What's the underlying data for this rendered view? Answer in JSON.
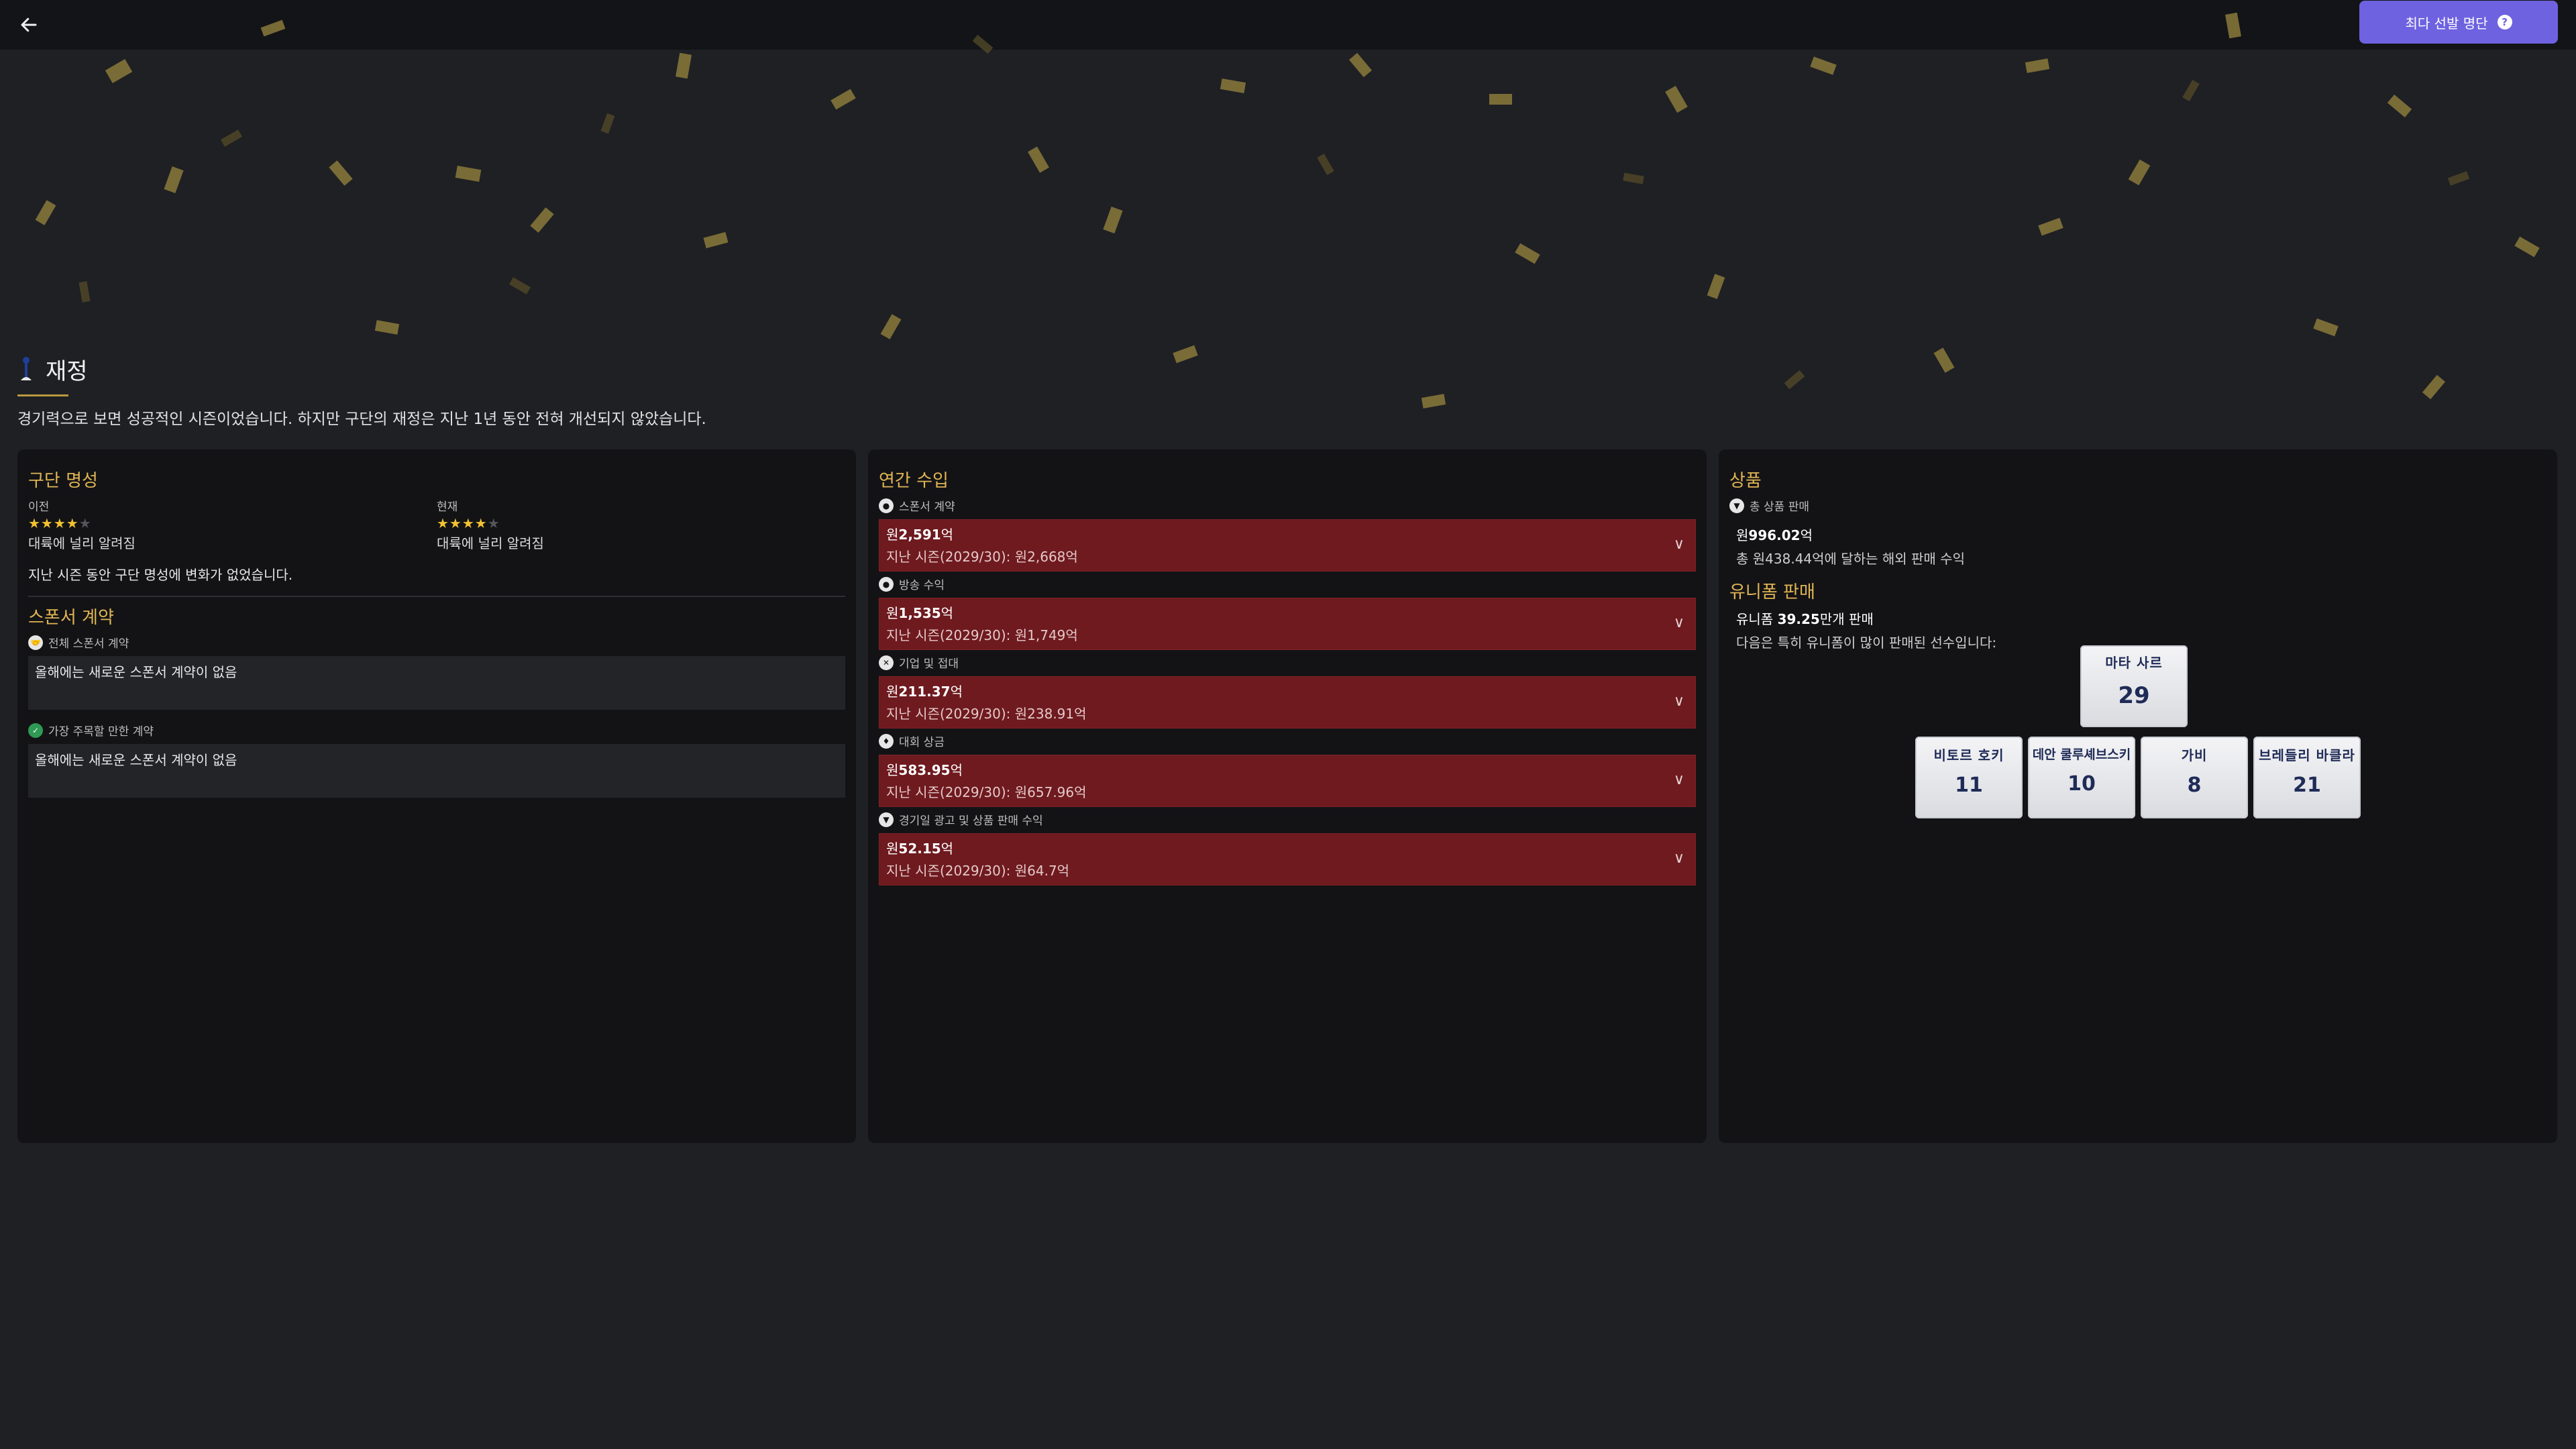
{
  "topbar": {
    "cta_label": "최다 선발 명단"
  },
  "page": {
    "title": "재정",
    "subtitle": "경기력으로 보면 성공적인 시즌이었습니다. 하지만 구단의 재정은 지난 1년 동안 전혀 개선되지 않았습니다."
  },
  "reputation": {
    "title": "구단 명성",
    "previous": {
      "label": "이전",
      "stars": 4,
      "max_stars": 5,
      "text": "대륙에 널리 알려짐"
    },
    "current": {
      "label": "현재",
      "stars": 4,
      "max_stars": 5,
      "text": "대륙에 널리 알려짐"
    },
    "note": "지난 시즌 동안 구단 명성에 변화가 없었습니다."
  },
  "sponsor": {
    "title": "스폰서 계약",
    "all_label": "전체 스폰서 계약",
    "all_value": "올해에는 새로운 스폰서 계약이 없음",
    "notable_label": "가장 주목할 만한 계약",
    "notable_value": "올해에는 새로운 스폰서 계약이 없음"
  },
  "revenue": {
    "title": "연간 수입",
    "items": [
      {
        "label": "스폰서 계약",
        "icon": "handshake-icon",
        "amount_prefix": "원",
        "amount": "2,591",
        "amount_unit": "억",
        "previous": "지난 시즌(2029/30): 원2,668억"
      },
      {
        "label": "방송 수익",
        "icon": "broadcast-icon",
        "amount_prefix": "원",
        "amount": "1,535",
        "amount_unit": "억",
        "previous": "지난 시즌(2029/30): 원1,749억"
      },
      {
        "label": "기업 및 접대",
        "icon": "hospitality-icon",
        "amount_prefix": "원",
        "amount": "211.37",
        "amount_unit": "억",
        "previous": "지난 시즌(2029/30): 원238.91억"
      },
      {
        "label": "대회 상금",
        "icon": "trophy-icon",
        "amount_prefix": "원",
        "amount": "583.95",
        "amount_unit": "억",
        "previous": "지난 시즌(2029/30): 원657.96억"
      },
      {
        "label": "경기일 광고 및 상품 판매 수익",
        "icon": "shirt-icon",
        "amount_prefix": "원",
        "amount": "52.15",
        "amount_unit": "억",
        "previous": "지난 시즌(2029/30): 원64.7억"
      }
    ]
  },
  "merch": {
    "title": "상품",
    "total_label": "총 상품 판매",
    "total_prefix": "원",
    "total_amount": "996.02",
    "total_unit": "억",
    "total_sub": "총 원438.44억에 달하는 해외 판매 수익",
    "uniform_title": "유니폼 판매",
    "uniform_prefix": "유니폼 ",
    "uniform_amount": "39.25",
    "uniform_suffix": "만개 판매",
    "uniform_sub": "다음은 특히 유니폼이 많이 판매된 선수입니다:",
    "jerseys": [
      {
        "name": "마타 사르",
        "number": "29"
      },
      {
        "name": "비토르 호키",
        "number": "11"
      },
      {
        "name": "데안 쿨루셰브스키",
        "number": "10"
      },
      {
        "name": "가비",
        "number": "8"
      },
      {
        "name": "브레들리 바클라",
        "number": "21"
      }
    ]
  },
  "colors": {
    "accent_gold": "#e0b553",
    "cta_purple": "#6e62e0",
    "revenue_red": "#6e1a1f",
    "star_yellow": "#f2c230"
  }
}
